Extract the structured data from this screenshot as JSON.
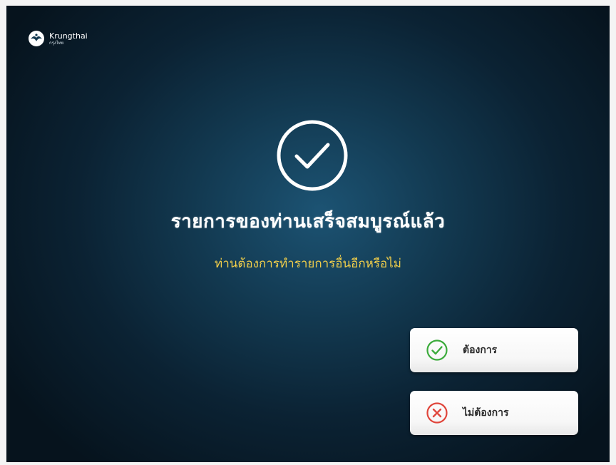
{
  "brand": {
    "name": "Krungthai",
    "subname": "กรุงไทย"
  },
  "status": {
    "icon": "check-circle-icon",
    "title": "รายการของท่านเสร็จสมบูรณ์แล้ว",
    "prompt": "ท่านต้องการทำรายการอื่นอีกหรือไม่"
  },
  "options": {
    "yes": {
      "label": "ต้องการ",
      "icon": "check-circle-icon",
      "color": "#3cab3c"
    },
    "no": {
      "label": "ไม่ต้องการ",
      "icon": "x-circle-icon",
      "color": "#e0463c"
    }
  },
  "colors": {
    "background": "#12384f",
    "prompt_text": "#f2cf4a",
    "title_text": "#ffffff"
  }
}
